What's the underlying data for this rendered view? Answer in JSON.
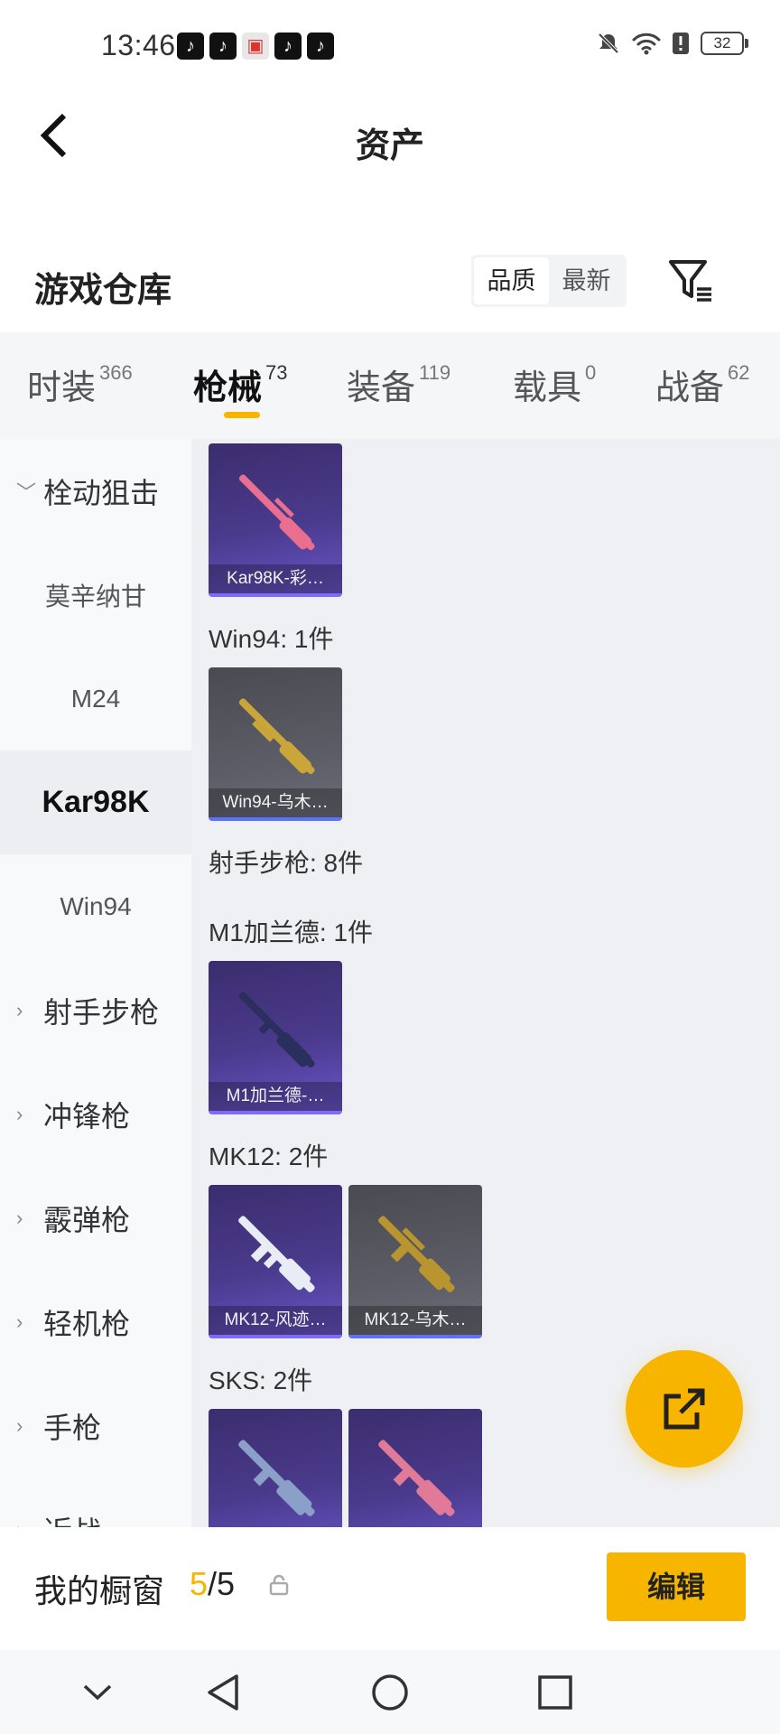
{
  "status_bar": {
    "time": "13:46",
    "notification_icons": [
      "tiktok-icon",
      "tiktok-icon",
      "package-icon",
      "tiktok-icon",
      "tiktok-icon"
    ],
    "battery_level": "32"
  },
  "header": {
    "title": "资产",
    "back_icon": "chevron-left-icon"
  },
  "warehouse": {
    "title": "游戏仓库",
    "sort_options": [
      "品质",
      "最新"
    ],
    "sort_selected": "品质",
    "filter_icon": "filter-icon"
  },
  "tabs": [
    {
      "label": "时装",
      "count": "366",
      "active": false
    },
    {
      "label": "枪械",
      "count": "73",
      "active": true
    },
    {
      "label": "装备",
      "count": "119",
      "active": false
    },
    {
      "label": "载具",
      "count": "0",
      "active": false
    },
    {
      "label": "战备",
      "count": "62",
      "active": false
    }
  ],
  "sidenav": [
    {
      "label": "栓动狙击",
      "type": "group",
      "expanded": true
    },
    {
      "label": "莫辛纳甘",
      "type": "sub"
    },
    {
      "label": "M24",
      "type": "sub"
    },
    {
      "label": "Kar98K",
      "type": "sub",
      "selected": true
    },
    {
      "label": "Win94",
      "type": "sub"
    },
    {
      "label": "射手步枪",
      "type": "group",
      "expanded": false
    },
    {
      "label": "冲锋枪",
      "type": "group",
      "expanded": false
    },
    {
      "label": "霰弹枪",
      "type": "group",
      "expanded": false
    },
    {
      "label": "轻机枪",
      "type": "group",
      "expanded": false
    },
    {
      "label": "手枪",
      "type": "group",
      "expanded": false
    },
    {
      "label": "近战",
      "type": "group",
      "expanded": false
    }
  ],
  "content": {
    "groups": [
      {
        "label": "Win94: 1件"
      },
      {
        "label": "射手步枪: 8件"
      },
      {
        "label": "M1加兰德: 1件"
      },
      {
        "label": "MK12: 2件"
      },
      {
        "label": "SKS: 2件"
      }
    ],
    "cards": [
      {
        "name": "Kar98K-彩…",
        "rarity": "purple",
        "gun_color": "#e86f8f"
      },
      {
        "name": "Win94-乌木…",
        "rarity": "grey",
        "gun_color": "#c9a53a"
      },
      {
        "name": "M1加兰德-…",
        "rarity": "purple",
        "gun_color": "#2a2f5e"
      },
      {
        "name": "MK12-风迹…",
        "rarity": "purple",
        "gun_color": "#e8ecf4"
      },
      {
        "name": "MK12-乌木…",
        "rarity": "grey",
        "gun_color": "#b8952e"
      },
      {
        "name": "",
        "rarity": "purple",
        "gun_color": "#8aa0c8"
      },
      {
        "name": "",
        "rarity": "purple",
        "gun_color": "#e07a98"
      }
    ]
  },
  "fab": {
    "icon": "share-icon"
  },
  "showcase": {
    "label": "我的橱窗",
    "current": "5",
    "total": "/5",
    "lock_icon": "lock-icon",
    "edit_label": "编辑"
  },
  "system_nav": {
    "icons": [
      "chevron-down-icon",
      "back-triangle-icon",
      "home-circle-icon",
      "recents-square-icon"
    ]
  },
  "colors": {
    "accent": "#f7b500",
    "purple_card": "#4a3a8c",
    "grey_card": "#5c5c66",
    "content_bg": "#eef0f4"
  }
}
